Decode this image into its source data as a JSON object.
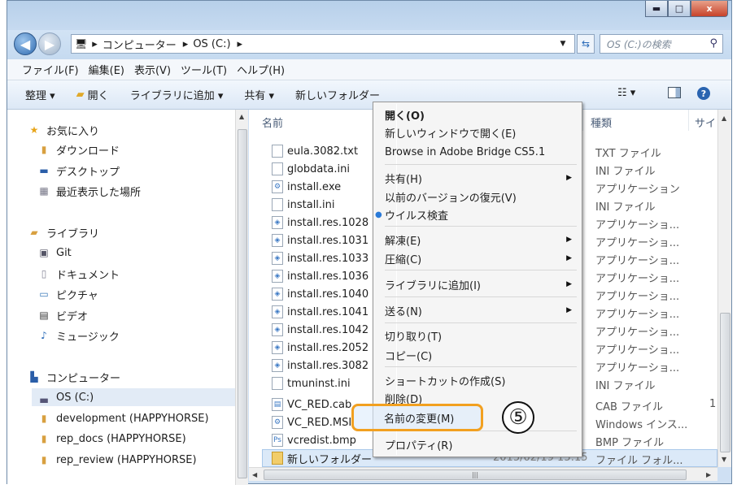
{
  "window_controls": {
    "minimize": "▬",
    "maximize": "□",
    "close": "x"
  },
  "address": {
    "crumbs": [
      "コンピューター",
      "OS (C:)"
    ],
    "search_placeholder": "OS (C:)の検索"
  },
  "menubar": [
    "ファイル(F)",
    "編集(E)",
    "表示(V)",
    "ツール(T)",
    "ヘルプ(H)"
  ],
  "toolbar": {
    "organize": "整理 ▾",
    "open": "開く",
    "add_to_library": "ライブラリに追加 ▾",
    "share": "共有 ▾",
    "new_folder": "新しいフォルダー"
  },
  "nav": {
    "favorites": "お気に入り",
    "downloads": "ダウンロード",
    "desktop": "デスクトップ",
    "recent": "最近表示した場所",
    "libraries": "ライブラリ",
    "git": "Git",
    "documents": "ドキュメント",
    "pictures": "ピクチャ",
    "videos": "ビデオ",
    "music": "ミュージック",
    "computer": "コンピューター",
    "os_c": "OS (C:)",
    "development": "development (HAPPYHORSE)",
    "rep_docs": "rep_docs (HAPPYHORSE)",
    "rep_review": "rep_review (HAPPYHORSE)"
  },
  "columns": {
    "name": "名前",
    "type": "種類",
    "size": "サイ"
  },
  "files": [
    {
      "name": "eula.3082.txt",
      "type": "TXT ファイル"
    },
    {
      "name": "globdata.ini",
      "type": "INI ファイル"
    },
    {
      "name": "install.exe",
      "type": "アプリケーション"
    },
    {
      "name": "install.ini",
      "type": "INI ファイル"
    },
    {
      "name": "install.res.1028",
      "type": "アプリケーショ..."
    },
    {
      "name": "install.res.1031",
      "type": "アプリケーショ..."
    },
    {
      "name": "install.res.1033",
      "type": "アプリケーショ..."
    },
    {
      "name": "install.res.1036",
      "type": "アプリケーショ..."
    },
    {
      "name": "install.res.1040",
      "type": "アプリケーショ..."
    },
    {
      "name": "install.res.1041",
      "type": "アプリケーショ..."
    },
    {
      "name": "install.res.1042",
      "type": "アプリケーショ..."
    },
    {
      "name": "install.res.2052",
      "type": "アプリケーショ..."
    },
    {
      "name": "install.res.3082",
      "type": "アプリケーショ..."
    },
    {
      "name": "tmuninst.ini",
      "type": "INI ファイル"
    },
    {
      "name": "VC_RED.cab",
      "type": "CAB ファイル",
      "size": "1"
    },
    {
      "name": "VC_RED.MSI",
      "type": "Windows インス..."
    },
    {
      "name": "vcredist.bmp",
      "type": "BMP ファイル"
    },
    {
      "name": "新しいフォルダー",
      "date": "2015/02/19 15:15",
      "type": "ファイル フォル..."
    }
  ],
  "context_menu": {
    "open": "開く(O)",
    "open_new_window": "新しいウィンドウで開く(E)",
    "bridge": "Browse in Adobe Bridge CS5.1",
    "share": "共有(H)",
    "restore": "以前のバージョンの復元(V)",
    "virus": "ウイルス検査",
    "extract": "解凍(E)",
    "compress": "圧縮(C)",
    "add_library": "ライブラリに追加(I)",
    "send_to": "送る(N)",
    "cut": "切り取り(T)",
    "copy": "コピー(C)",
    "shortcut": "ショートカットの作成(S)",
    "delete": "削除(D)",
    "rename": "名前の変更(M)",
    "properties": "プロパティ(R)"
  },
  "step_badge": "⑤",
  "colors": {
    "highlight": "#f2a020",
    "selection": "#dbe9f8"
  }
}
